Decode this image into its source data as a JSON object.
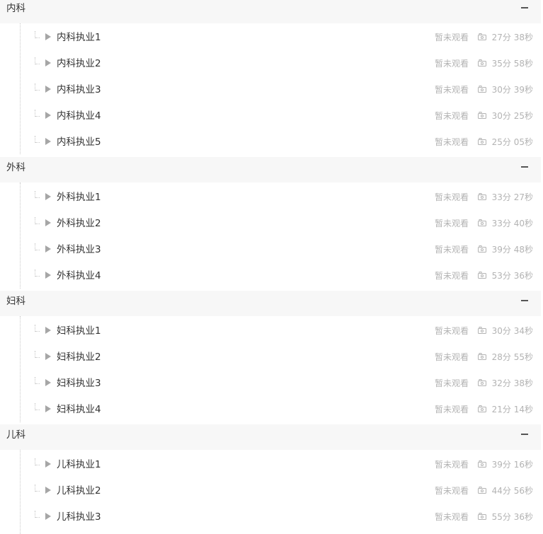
{
  "sections": [
    {
      "title": "内科",
      "lessons": [
        {
          "title": "内科执业1",
          "status": "暂未观看",
          "duration": "27分 38秒"
        },
        {
          "title": "内科执业2",
          "status": "暂未观看",
          "duration": "35分 58秒"
        },
        {
          "title": "内科执业3",
          "status": "暂未观看",
          "duration": "30分 39秒"
        },
        {
          "title": "内科执业4",
          "status": "暂未观看",
          "duration": "30分 25秒"
        },
        {
          "title": "内科执业5",
          "status": "暂未观看",
          "duration": "25分 05秒"
        }
      ]
    },
    {
      "title": "外科",
      "lessons": [
        {
          "title": "外科执业1",
          "status": "暂未观看",
          "duration": "33分 27秒"
        },
        {
          "title": "外科执业2",
          "status": "暂未观看",
          "duration": "33分 40秒"
        },
        {
          "title": "外科执业3",
          "status": "暂未观看",
          "duration": "39分 48秒"
        },
        {
          "title": "外科执业4",
          "status": "暂未观看",
          "duration": "53分 36秒"
        }
      ]
    },
    {
      "title": "妇科",
      "lessons": [
        {
          "title": "妇科执业1",
          "status": "暂未观看",
          "duration": "30分 34秒"
        },
        {
          "title": "妇科执业2",
          "status": "暂未观看",
          "duration": "28分 55秒"
        },
        {
          "title": "妇科执业3",
          "status": "暂未观看",
          "duration": "32分 38秒"
        },
        {
          "title": "妇科执业4",
          "status": "暂未观看",
          "duration": "21分 14秒"
        }
      ]
    },
    {
      "title": "儿科",
      "lessons": [
        {
          "title": "儿科执业1",
          "status": "暂未观看",
          "duration": "39分 16秒"
        },
        {
          "title": "儿科执业2",
          "status": "暂未观看",
          "duration": "44分 56秒"
        },
        {
          "title": "儿科执业3",
          "status": "暂未观看",
          "duration": "55分 36秒"
        }
      ]
    }
  ],
  "icons": {
    "collapse": "minus-icon",
    "play": "play-icon",
    "video": "camera-icon"
  },
  "colors": {
    "header_background": "#f7f7f7",
    "text_primary": "#333333",
    "text_muted": "#b3b3b3",
    "icon_gray": "#a6a6a6"
  }
}
